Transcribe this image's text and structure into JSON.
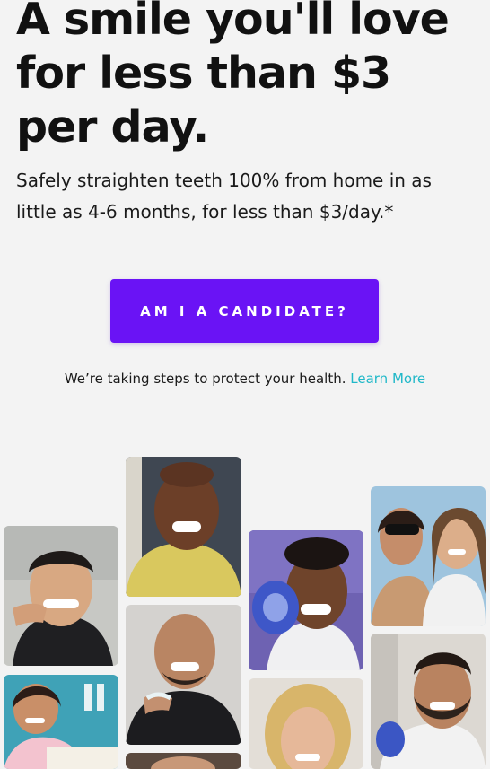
{
  "hero": {
    "heading": "A smile you'll love for less than $3 per day.",
    "subheading": "Safely straighten teeth 100% from home in as little as 4-6 months, for less than $3/day.*"
  },
  "cta": {
    "label": "AM I A CANDIDATE?"
  },
  "health_note": {
    "text": "We’re taking steps to protect your health.",
    "link_label": "Learn More"
  },
  "colors": {
    "background": "#f3f3f3",
    "cta_background": "#6a13f5",
    "link": "#20b8c8"
  }
}
